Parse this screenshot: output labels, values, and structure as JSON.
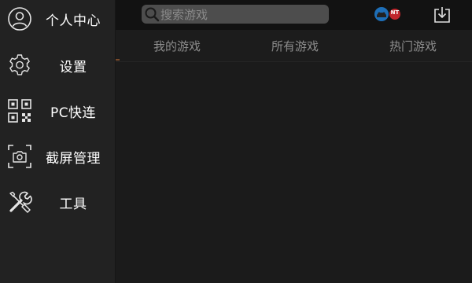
{
  "sidebar": {
    "items": [
      {
        "label": "个人中心",
        "icon": "user-icon"
      },
      {
        "label": "设置",
        "icon": "gear-icon"
      },
      {
        "label": "PC快连",
        "icon": "qr-code-icon"
      },
      {
        "label": "截屏管理",
        "icon": "camera-icon"
      },
      {
        "label": "工具",
        "icon": "tools-icon"
      }
    ]
  },
  "topbar": {
    "search_placeholder": "搜索游戏",
    "badge_text": "NT",
    "colors": {
      "badge_blue": "#1e6fb8",
      "badge_red": "#c0262c"
    }
  },
  "tabs": [
    {
      "label": "我的游戏"
    },
    {
      "label": "所有游戏"
    },
    {
      "label": "热门游戏"
    }
  ],
  "colors": {
    "sidebar_bg": "#222222",
    "topbar_bg": "#121212",
    "tab_text": "#8c8c8c",
    "search_bg": "#4d4d4d"
  }
}
